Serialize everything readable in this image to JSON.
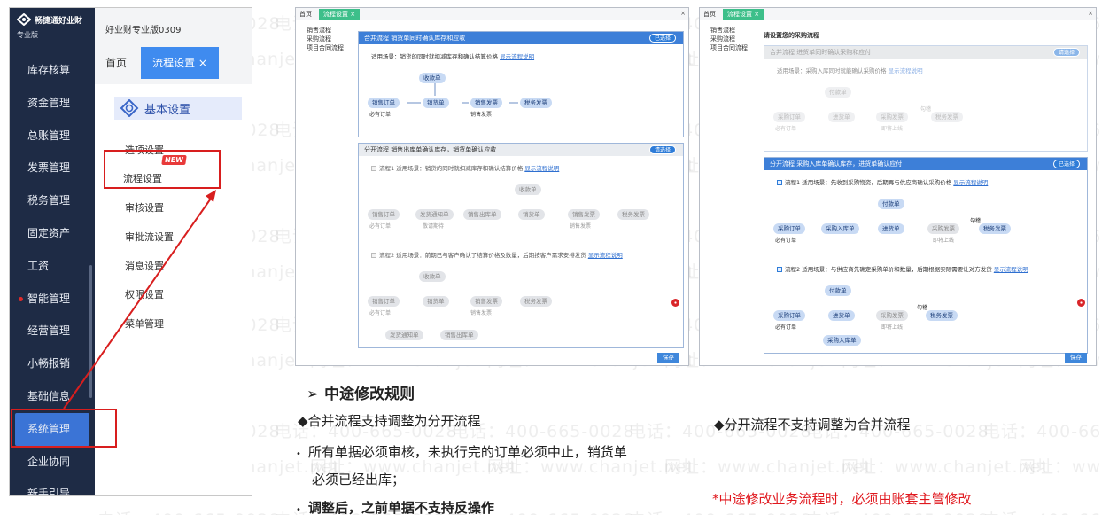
{
  "watermark": {
    "phone": "电话：400-665-0028",
    "site": "网址：www.chanjet.net"
  },
  "app": {
    "logo": "畅捷通好业财",
    "logo_sub": "专业版",
    "edition": "好业财专业版0309",
    "nav": [
      "库存核算",
      "资金管理",
      "总账管理",
      "发票管理",
      "税务管理",
      "固定资产",
      "工资",
      "智能管理",
      "经营管理",
      "小畅报销",
      "基础信息",
      "系统管理",
      "企业协同",
      "新手引导"
    ],
    "tab_home": "首页",
    "tab_process": "流程设置 ×",
    "basic_settings": "基本设置",
    "menu": [
      "选项设置",
      "流程设置",
      "审核设置",
      "审批流设置",
      "消息设置",
      "权限设置",
      "菜单管理"
    ],
    "new_badge": "NEW"
  },
  "panel1": {
    "tab_home": "首页",
    "tab_process": "流程设置 ×",
    "close": "×",
    "side": [
      "销售流程",
      "采购流程",
      "项目合同流程"
    ],
    "merged": {
      "title": "合并流程   销货单同时确认库存和应收",
      "badge": "已选择",
      "scene": "适用场景：销货的同时就扣减库存和确认结算价格",
      "link": "显示流程说明",
      "n_receipt": "收款单",
      "n_order": "销售订单",
      "n_delivery": "销货单",
      "n_invoice": "销售发票",
      "n_tax": "税务发票",
      "note1": "必有订单",
      "note2": "销售发票"
    },
    "split": {
      "title": "分开流程   销售出库单确认库存，销货单确认应收",
      "badge": "请选择",
      "f1": "流程1  适用场景：销货的同时就扣减库存和确认结算价格",
      "f2": "流程2  适用场景：前期已与客户确认了结算价格及数量，后期按客户需求安排发货",
      "link": "显示流程说明",
      "n_receipt": "收款单",
      "n_order": "销售订单",
      "n_notice": "发货通知单",
      "n_outbound": "销售出库单",
      "n_delivery": "销货单",
      "n_invoice": "销售发票",
      "n_tax": "税务发票",
      "note1": "必有订单",
      "note2": "敬请期待",
      "note3": "销售发票"
    },
    "save": "保存"
  },
  "panel2": {
    "tab_home": "首页",
    "tab_process": "流程设置 ×",
    "close": "×",
    "side": [
      "销售流程",
      "采购流程",
      "项目合同流程"
    ],
    "choose": "请设置您的采购流程",
    "merged": {
      "title": "合并流程   进货单同时确认采购和应付",
      "badge": "请选择",
      "scene": "适用场景：采购入库同时就能确认采购价格",
      "link": "显示流程说明",
      "n_pay": "付款单",
      "n_order": "采购订单",
      "n_receipt": "进货单",
      "n_invoice": "采购发票",
      "n_tax": "税务发票",
      "note1": "必有订单",
      "note2": "即将上线",
      "note3": "勾稽"
    },
    "split": {
      "title": "分开流程   采购入库单确认库存，进货单确认应付",
      "badge": "已选择",
      "f1": "流程1  适用场景：先收到采购物资，后期再与供应商确认采购价格",
      "f2": "流程2  适用场景：与供应商先确定采购单价和数量，后期根据实际需要让对方发货",
      "link": "显示流程说明",
      "n_pay": "付款单",
      "n_order": "采购订单",
      "n_inbound": "采购入库单",
      "n_receipt": "进货单",
      "n_invoice": "采购发票",
      "n_tax": "税务发票",
      "note1": "必有订单",
      "note2": "即将上线",
      "note3": "勾稽"
    },
    "save": "保存"
  },
  "text": {
    "heading": "中途修改规则",
    "left1": "◆合并流程支持调整为分开流程",
    "left2": "所有单据必须审核，未执行完的订单必须中止，销货单",
    "left3": "必须已经出库；",
    "left4": "调整后，之前单据不支持反操作",
    "right1": "◆分开流程不支持调整为合并流程",
    "right2": "*中途修改业务流程时，必须由账套主管修改"
  },
  "colors": {
    "sidebar": "#1e2b45",
    "accent": "#3f8bef",
    "highlight": "#d81e1e",
    "tab_green": "#3dbf8a",
    "warning_text": "#e0181e"
  }
}
